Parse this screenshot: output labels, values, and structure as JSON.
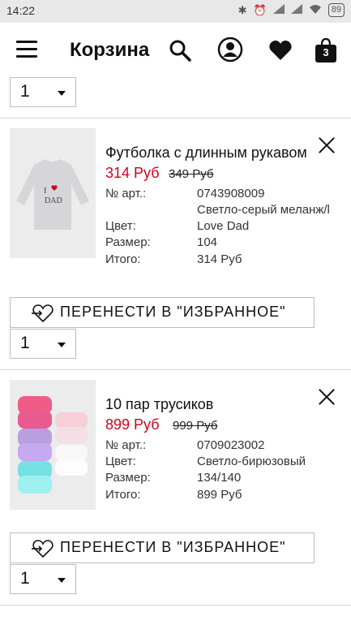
{
  "status_bar": {
    "time": "14:22",
    "battery": "89"
  },
  "header": {
    "title": "Корзина",
    "bag_count": "3"
  },
  "top_quantity": "1",
  "items": [
    {
      "name": "Футболка с длинным рукавом",
      "price": "314 Руб",
      "old_price": "349 Руб",
      "details": [
        {
          "label": "№ арт.:",
          "value": "0743908009"
        },
        {
          "label": "",
          "value": "Светло-серый меланж/l"
        },
        {
          "label": "Цвет:",
          "value": "Love Dad"
        },
        {
          "label": "Размер:",
          "value": "104"
        },
        {
          "label": "Итого:",
          "value": "314 Руб"
        }
      ],
      "move_label": "ПЕРЕНЕСТИ В \"ИЗБРАННОЕ\"",
      "quantity": "1"
    },
    {
      "name": "10 пар трусиков",
      "price": "899 Руб",
      "old_price": "999 Руб",
      "details": [
        {
          "label": "№ арт.:",
          "value": "0709023002"
        },
        {
          "label": "Цвет:",
          "value": "Светло-бирюзовый"
        },
        {
          "label": "Размер:",
          "value": "134/140"
        },
        {
          "label": "Итого:",
          "value": "899 Руб"
        }
      ],
      "move_label": "ПЕРЕНЕСТИ В \"ИЗБРАННОЕ\"",
      "quantity": "1"
    }
  ],
  "thumb_texts": {
    "tee_print_line1": "I",
    "tee_print_line2": "DAD"
  },
  "colors": {
    "sale_red": "#d0021b",
    "border": "#bdbdbd",
    "divider": "#d7d7d7"
  }
}
